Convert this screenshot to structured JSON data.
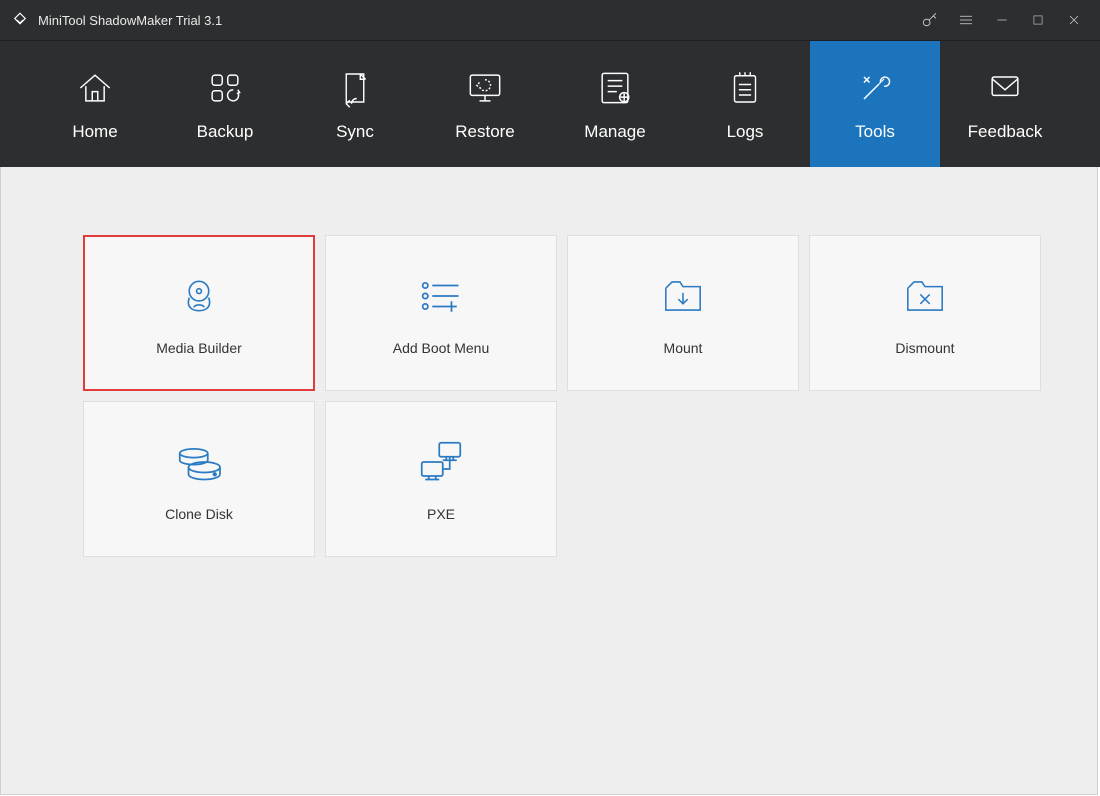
{
  "app": {
    "title": "MiniTool ShadowMaker Trial 3.1"
  },
  "nav": {
    "home": "Home",
    "backup": "Backup",
    "sync": "Sync",
    "restore": "Restore",
    "manage": "Manage",
    "logs": "Logs",
    "tools": "Tools",
    "feedback": "Feedback",
    "active": "tools"
  },
  "tools": {
    "media_builder": "Media Builder",
    "add_boot_menu": "Add Boot Menu",
    "mount": "Mount",
    "dismount": "Dismount",
    "clone_disk": "Clone Disk",
    "pxe": "PXE",
    "selected": "media_builder"
  },
  "colors": {
    "accent": "#1c75bc",
    "icon_blue": "#2b7bc4",
    "selection": "#e23b3b"
  }
}
